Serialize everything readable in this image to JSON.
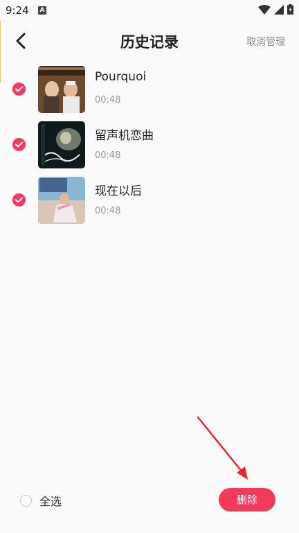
{
  "status_bar": {
    "time": "9:24",
    "notification_letter": "A"
  },
  "header": {
    "title": "历史记录",
    "cancel_manage": "取消管理"
  },
  "songs": [
    {
      "name": "Pourquoi",
      "duration": "00:48",
      "checked": true
    },
    {
      "name": "留声机恋曲",
      "duration": "00:48",
      "checked": true
    },
    {
      "name": "现在以后",
      "duration": "00:48",
      "checked": true
    }
  ],
  "bottom": {
    "select_all": "全选",
    "delete": "删除"
  },
  "colors": {
    "accent": "#f3395c",
    "muted": "#9a9a9a",
    "arrow": "#e8262b"
  },
  "icons": [
    "back-arrow-icon",
    "check-circle-icon",
    "wifi-icon",
    "signal-icon",
    "battery-icon"
  ]
}
